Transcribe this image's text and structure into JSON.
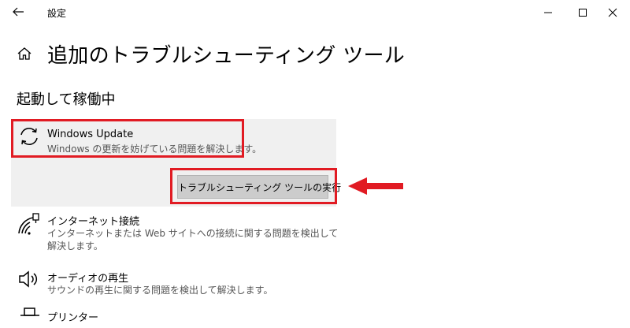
{
  "titlebar": {
    "app_title": "設定",
    "back_icon": "back-arrow-icon",
    "minimize_icon": "minimize-icon",
    "maximize_icon": "maximize-icon",
    "close_icon": "close-icon"
  },
  "header": {
    "home_icon": "home-icon",
    "page_title": "追加のトラブルシューティング ツール"
  },
  "section": {
    "heading": "起動して稼働中"
  },
  "selected_item": {
    "icon": "sync-icon",
    "name": "Windows Update",
    "description": "Windows の更新を妨げている問題を解決します。",
    "run_button_label": "トラブルシューティング ツールの実行"
  },
  "items": [
    {
      "icon": "network-icon",
      "name": "インターネット接続",
      "description": "インターネットまたは Web サイトへの接続に関する問題を検出して解決します。"
    },
    {
      "icon": "speaker-icon",
      "name": "オーディオの再生",
      "description": "サウンドの再生に関する問題を検出して解決します。"
    },
    {
      "icon": "printer-icon",
      "name": "プリンター",
      "description": ""
    }
  ],
  "colors": {
    "annotation_red": "#e11b23",
    "selected_background": "#f0f0f0",
    "button_background": "#cccccc"
  }
}
